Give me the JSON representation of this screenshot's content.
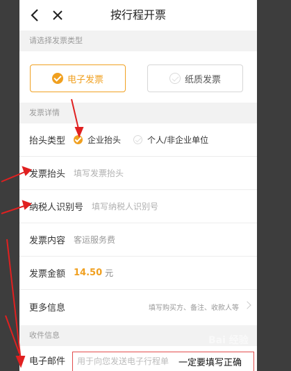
{
  "header": {
    "title": "按行程开票"
  },
  "invoice_type": {
    "section_label": "请选择发票类型",
    "options": [
      {
        "label": "电子发票",
        "selected": true
      },
      {
        "label": "纸质发票",
        "selected": false
      }
    ]
  },
  "details": {
    "section_label": "发票详情",
    "title_type": {
      "label": "抬头类型",
      "options": [
        {
          "label": "企业抬头",
          "selected": true
        },
        {
          "label": "个人/非企业单位",
          "selected": false
        }
      ]
    },
    "invoice_title": {
      "label": "发票抬头",
      "placeholder": "填写发票抬头"
    },
    "tax_id": {
      "label": "纳税人识别号",
      "placeholder": "填写纳税人识别号"
    },
    "content": {
      "label": "发票内容",
      "value": "客运服务费"
    },
    "amount": {
      "label": "发票金额",
      "value": "14.50",
      "unit": "元"
    },
    "more": {
      "label": "更多信息",
      "hint": "填写购买方、备注、收款人等"
    }
  },
  "receive": {
    "section_label": "收件信息",
    "email": {
      "label": "电子邮件",
      "placeholder": "用于向您发送电子行程单"
    }
  },
  "annotation": {
    "note": "一定要填写正确",
    "arrow_color": "#e02020"
  },
  "watermark": "Bai 经验",
  "colors": {
    "accent": "#f0a020",
    "highlight_border": "#e24a4a"
  }
}
